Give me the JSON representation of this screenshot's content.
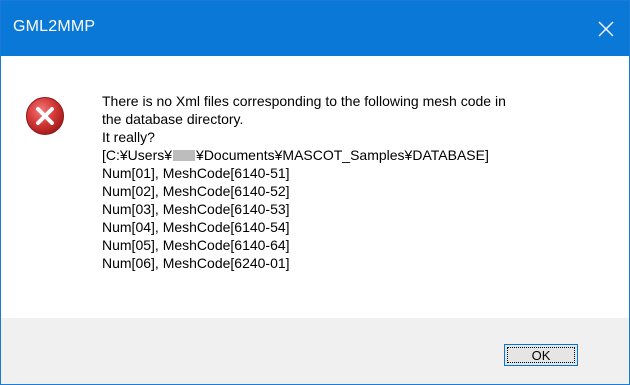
{
  "window": {
    "title": "GML2MMP",
    "accent_color": "#0a78d7"
  },
  "icons": {
    "close": "close-icon",
    "error": "error-icon"
  },
  "message": {
    "line1": "There is no Xml files corresponding to the following mesh code in",
    "line2": "the database directory.",
    "line3": "It really?",
    "path_prefix": "[C:¥Users¥",
    "path_suffix": "¥Documents¥MASCOT_Samples¥DATABASE]",
    "items": [
      "Num[01], MeshCode[6140-51]",
      "Num[02], MeshCode[6140-52]",
      "Num[03], MeshCode[6140-53]",
      "Num[04], MeshCode[6140-54]",
      "Num[05], MeshCode[6140-64]",
      "Num[06], MeshCode[6240-01]"
    ]
  },
  "buttons": {
    "ok_label": "OK"
  }
}
